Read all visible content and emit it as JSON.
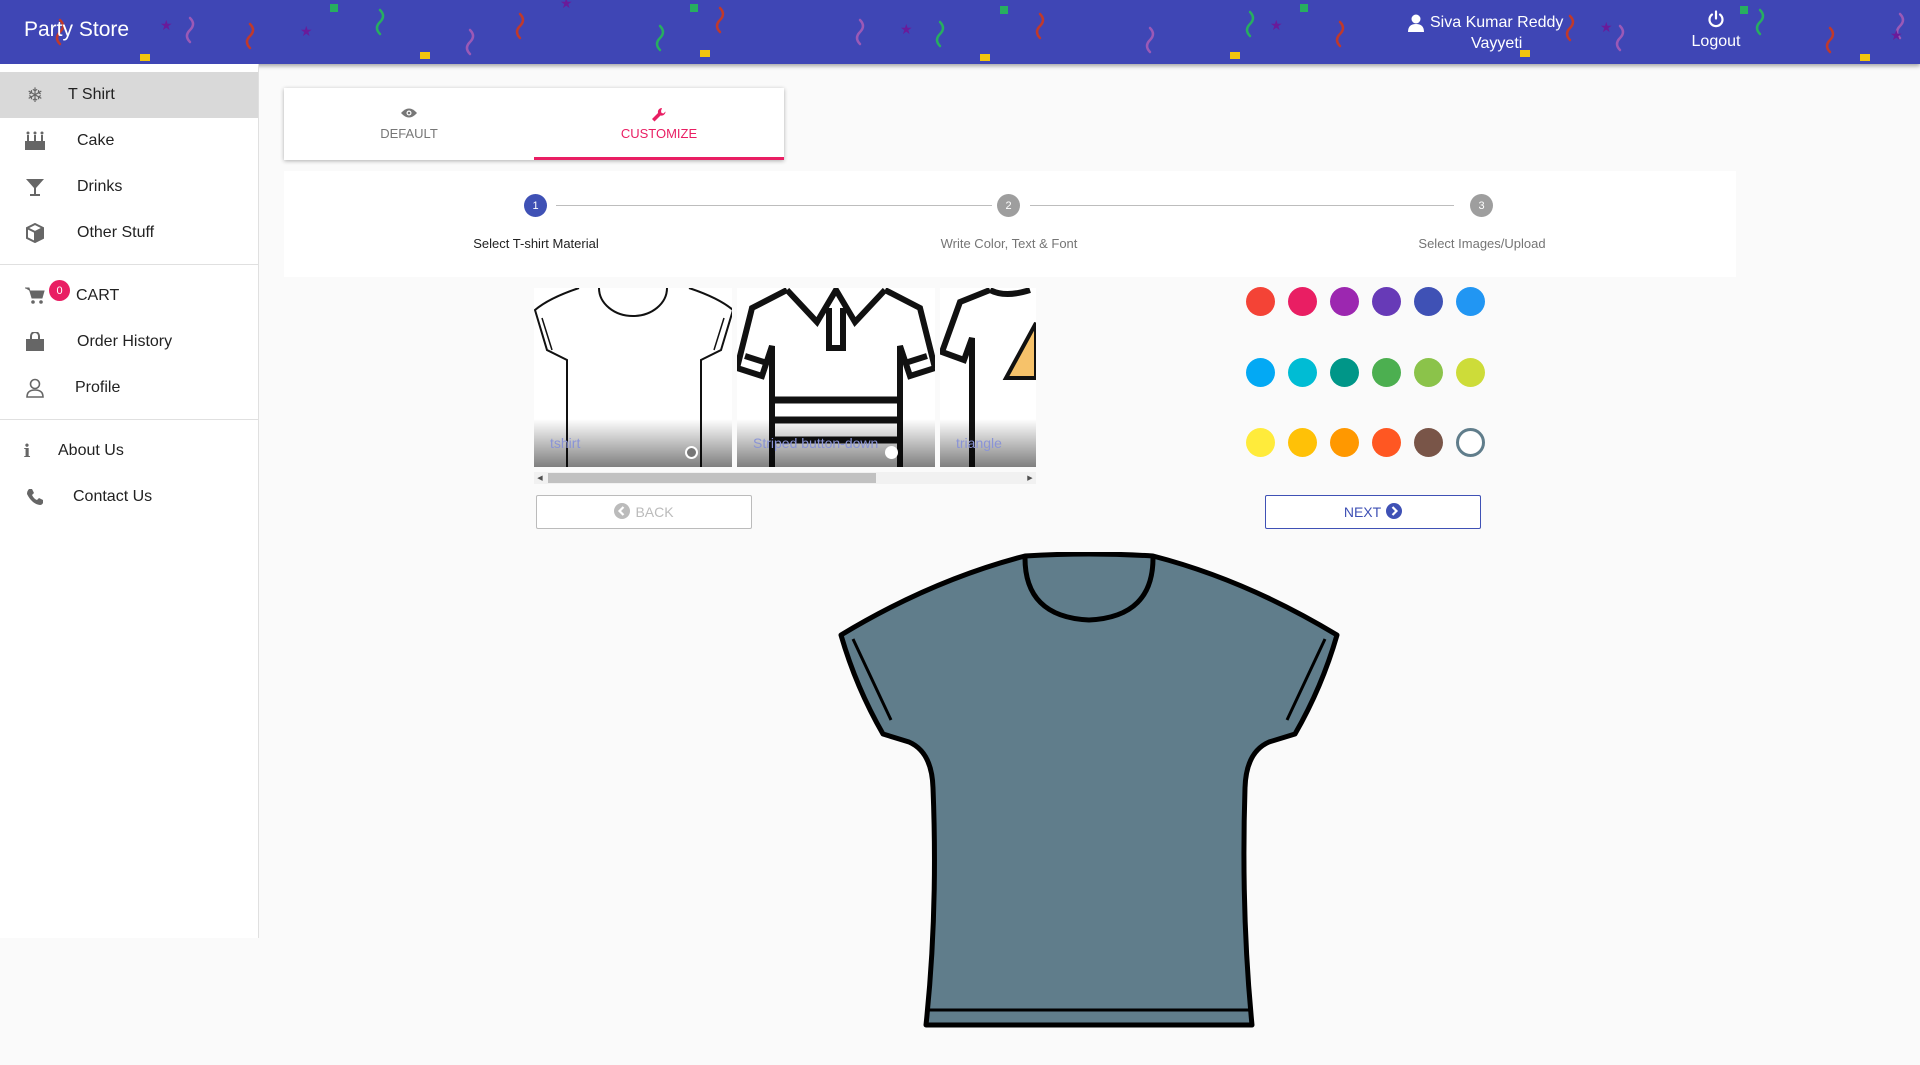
{
  "app": {
    "title": "Party Store"
  },
  "header": {
    "user_line1": "Siva Kumar Reddy",
    "user_line2": "Vayyeti",
    "logout_label": "Logout",
    "background_color": "#3f46b5"
  },
  "sidebar": {
    "items": [
      {
        "label": "T Shirt",
        "icon": "snowflake-icon",
        "active": true
      },
      {
        "label": "Cake",
        "icon": "birthday-cake-icon"
      },
      {
        "label": "Drinks",
        "icon": "cocktail-glass-icon"
      },
      {
        "label": "Other Stuff",
        "icon": "cube-icon"
      }
    ],
    "cart": {
      "label": "CART",
      "badge": "0",
      "icon": "cart-icon"
    },
    "items2": [
      {
        "label": "Order History",
        "icon": "shopping-bag-icon"
      },
      {
        "label": "Profile",
        "icon": "user-outline-icon"
      }
    ],
    "items3": [
      {
        "label": "About Us",
        "icon": "info-icon"
      },
      {
        "label": "Contact Us",
        "icon": "phone-icon"
      }
    ]
  },
  "tabs": [
    {
      "label": "DEFAULT",
      "icon": "eye-icon",
      "active": false
    },
    {
      "label": "CUSTOMIZE",
      "icon": "wrench-icon",
      "active": true
    }
  ],
  "stepper": {
    "steps": [
      {
        "number": "1",
        "label": "Select T-shirt Material",
        "active": true
      },
      {
        "number": "2",
        "label": "Write Color, Text & Font",
        "active": false
      },
      {
        "number": "3",
        "label": "Select Images/Upload",
        "active": false
      }
    ]
  },
  "gallery": {
    "tiles": [
      {
        "title": "tshirt"
      },
      {
        "title": "Striped button-down"
      },
      {
        "title": "triangle"
      }
    ]
  },
  "buttons": {
    "back_label": "BACK",
    "next_label": "NEXT"
  },
  "palette": {
    "colors": [
      "#f44336",
      "#e91e63",
      "#9c27b0",
      "#673ab7",
      "#3f51b5",
      "#2196f3",
      "#03a9f4",
      "#00bcd4",
      "#009688",
      "#4caf50",
      "#8bc34a",
      "#cddc39",
      "#ffeb3b",
      "#ffc107",
      "#ff9800",
      "#ff5722",
      "#795548",
      "#607d8b"
    ],
    "selected_index": 17
  },
  "preview": {
    "shirt_color": "#607d8b"
  }
}
